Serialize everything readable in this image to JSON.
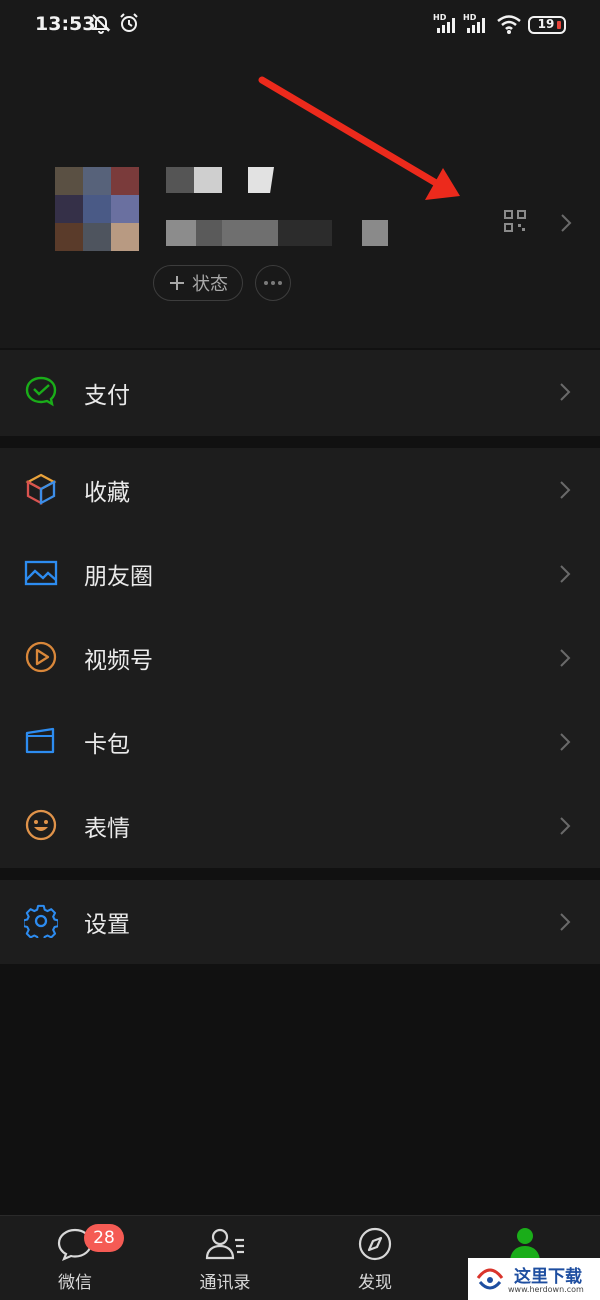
{
  "status_bar": {
    "time": "13:53",
    "battery": "19",
    "icons": [
      "mute-bell-icon",
      "alarm-icon",
      "hd-signal-icon",
      "hd-signal-icon",
      "wifi-icon",
      "battery-icon"
    ]
  },
  "profile": {
    "status_button": "状态",
    "icons": [
      "qr-code-icon",
      "chevron-right-icon",
      "plus-icon",
      "more-icon"
    ]
  },
  "menu": {
    "pay": {
      "label": "支付",
      "icon": "wechat-pay-icon",
      "color": "#1aad19"
    },
    "favorites": {
      "label": "收藏",
      "icon": "cube-icon"
    },
    "moments": {
      "label": "朋友圈",
      "icon": "picture-icon",
      "color": "#2d8cf0"
    },
    "channels": {
      "label": "视频号",
      "icon": "play-circle-icon",
      "color": "#d9873a"
    },
    "card": {
      "label": "卡包",
      "icon": "wallet-icon",
      "color": "#2d8cf0"
    },
    "stickers": {
      "label": "表情",
      "icon": "smiley-icon",
      "color": "#e0934a"
    },
    "settings": {
      "label": "设置",
      "icon": "gear-icon",
      "color": "#2d8cf0"
    }
  },
  "bottom_nav": {
    "chats": {
      "label": "微信",
      "badge": "28"
    },
    "contacts": {
      "label": "通讯录"
    },
    "discover": {
      "label": "发现"
    },
    "me": {
      "label": "",
      "color": "#1aad19"
    }
  },
  "watermark": {
    "text": "这里下载",
    "url": "www.herdown.com"
  }
}
